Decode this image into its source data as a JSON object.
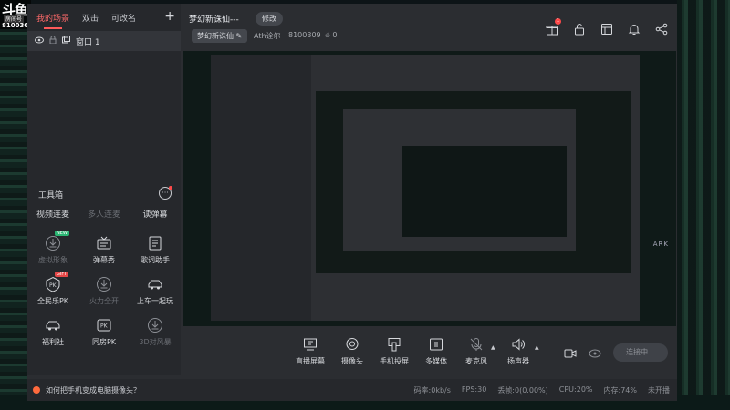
{
  "logo": {
    "mark": "斗鱼",
    "sub": "房间号",
    "room_id": "8100309"
  },
  "sidebar": {
    "tabs": [
      {
        "label": "我的场景",
        "active": true
      },
      {
        "label": "双击"
      },
      {
        "label": "可改名"
      }
    ],
    "add_label": "+",
    "scene": {
      "label": "窗口 1"
    },
    "toolbox": {
      "title": "工具箱",
      "more_label": "···"
    },
    "tool_tabs": [
      {
        "label": "视频连麦",
        "dim": false
      },
      {
        "label": "多人连麦",
        "dim": true
      },
      {
        "label": "读弹幕",
        "dim": false
      }
    ],
    "tools": [
      {
        "label": "虚拟形象",
        "icon": "download-icon",
        "dim": true,
        "badge": "NEW"
      },
      {
        "label": "弹幕秀",
        "icon": "tv-icon",
        "dim": false
      },
      {
        "label": "歌词助手",
        "icon": "lyrics-icon",
        "dim": false
      },
      {
        "label": "全民乐PK",
        "icon": "pk-icon",
        "dim": false,
        "badge": "GIFT"
      },
      {
        "label": "火力全开",
        "icon": "download-icon",
        "dim": true
      },
      {
        "label": "上车一起玩",
        "icon": "car-icon",
        "dim": false
      },
      {
        "label": "福利社",
        "icon": "car-icon",
        "dim": false
      },
      {
        "label": "同房PK",
        "icon": "pk-icon",
        "dim": false
      },
      {
        "label": "3D对风暴",
        "icon": "download-icon",
        "dim": true
      }
    ]
  },
  "header": {
    "title": "梦幻新诛仙---",
    "edit_label": "修改",
    "category": "梦幻新诛仙",
    "user": "Ath诠尔",
    "room": "8100309",
    "fire_count": "0",
    "notification_count": "1",
    "icons": [
      "gift-icon",
      "lock-icon",
      "layout-icon",
      "bell-icon",
      "share-icon"
    ]
  },
  "preview": {
    "watermark": "ARK"
  },
  "bottom_bar": {
    "buttons": [
      {
        "label": "直播屏幕",
        "icon": "screen-icon"
      },
      {
        "label": "摄像头",
        "icon": "camera-icon"
      },
      {
        "label": "手机投屏",
        "icon": "phone-cast-icon"
      },
      {
        "label": "多媒体",
        "icon": "media-icon"
      },
      {
        "label": "麦克风",
        "icon": "microphone-icon"
      },
      {
        "label": "扬声器",
        "icon": "speaker-icon"
      }
    ],
    "record_icon": "record-icon",
    "eye_icon": "eye-icon",
    "settings_icon": "gear-icon",
    "live_label": "连接中..."
  },
  "status_bar": {
    "tip": "如何把手机变成电脑摄像头？",
    "stats": [
      "码率:0kb/s",
      "FPS:30",
      "丢帧:0(0.00%)",
      "CPU:20%",
      "内存:74%",
      "未开播"
    ]
  },
  "colors": {
    "accent": "#ff5a5a",
    "panel": "#2b2d31",
    "sidebar": "#26282c"
  }
}
